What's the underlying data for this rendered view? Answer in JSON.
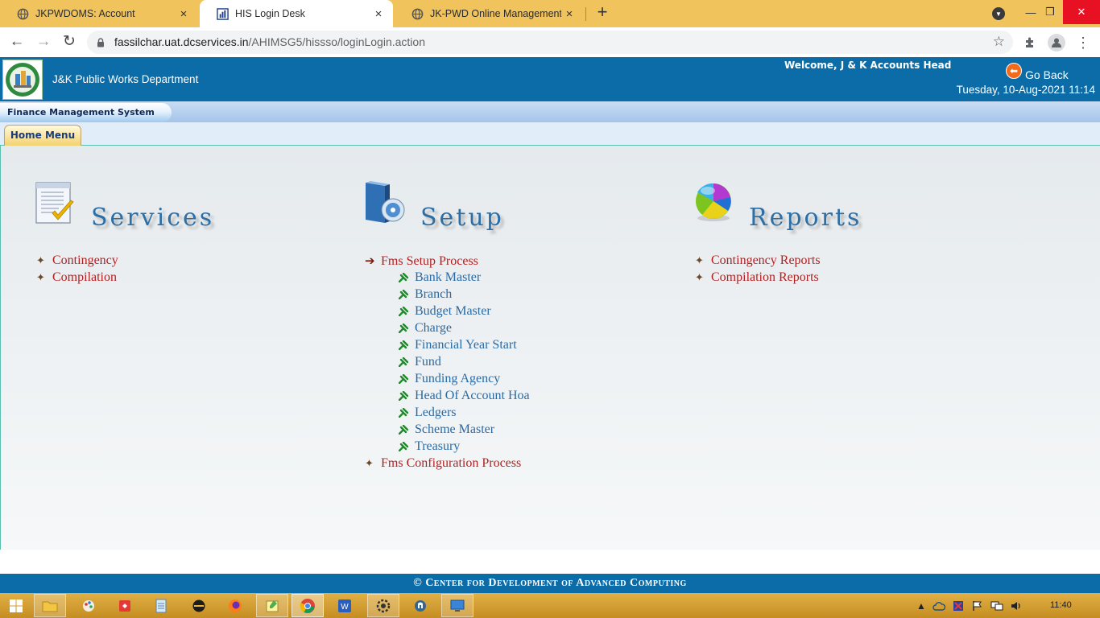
{
  "browser": {
    "tabs": [
      {
        "title": "JKPWDOMS: Account",
        "close": "×",
        "active": false
      },
      {
        "title": "HIS Login Desk",
        "close": "×",
        "active": true
      },
      {
        "title": "JK-PWD Online Management Sys",
        "close": "×",
        "active": false
      }
    ],
    "new_tab": "+",
    "url_host": "fassilchar.uat.dcservices.in",
    "url_path": "/AHIMSG5/hissso/loginLogin.action",
    "window_controls": {
      "minimize": "—",
      "restore": "❐",
      "close": "✕"
    }
  },
  "header": {
    "department": "J&K Public Works Department",
    "welcome": "Welcome, J & K Accounts Head",
    "go_back": "Go Back",
    "datetime": "Tuesday, 10-Aug-2021 11:14"
  },
  "system_tab": "Finance Management System",
  "home_tab": "Home Menu",
  "sections": {
    "services": {
      "title": "Services",
      "items": [
        "Contingency",
        "Compilation"
      ]
    },
    "setup": {
      "title": "Setup",
      "process": "Fms Setup Process",
      "sub_items": [
        "Bank Master",
        "Branch",
        "Budget Master",
        "Charge",
        "Financial Year Start",
        "Fund",
        "Funding Agency",
        "Head Of Account Hoa",
        "Ledgers",
        "Scheme Master",
        "Treasury"
      ],
      "config": "Fms Configuration Process"
    },
    "reports": {
      "title": "Reports",
      "items": [
        "Contingency Reports",
        "Compilation Reports"
      ]
    }
  },
  "footer": "© Center for Development of Advanced Computing",
  "taskbar": {
    "clock": "11:40"
  },
  "colors": {
    "header_bg": "#0b6ca8",
    "link_red": "#b32020",
    "link_blue": "#2a6aa3",
    "title_blue": "#2c6fa6",
    "tabbar_bg": "#f0c35c"
  }
}
